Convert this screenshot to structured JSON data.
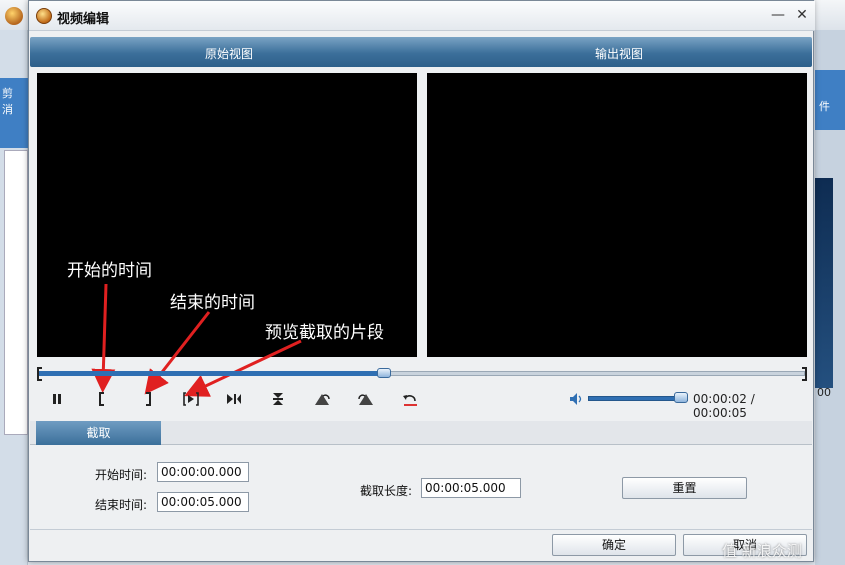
{
  "dialog": {
    "title": "视频编辑"
  },
  "views": {
    "original_label": "原始视图",
    "output_label": "输出视图"
  },
  "annotations": {
    "start_time": "开始的时间",
    "end_time": "结束的时间",
    "preview_clip": "预览截取的片段"
  },
  "timeline": {
    "position_fraction": 0.45
  },
  "playback": {
    "time_readout": "00:00:02 / 00:00:05",
    "volume_fraction": 1.0
  },
  "tabs": [
    {
      "label": "截取"
    }
  ],
  "form": {
    "start_label": "开始时间:",
    "start_value": "00:00:00.000",
    "end_label": "结束时间:",
    "end_value": "00:00:05.000",
    "length_label": "截取长度:",
    "length_value": "00:00:05.000",
    "reset_label": "重置"
  },
  "footer": {
    "ok_label": "确定",
    "cancel_label": "取消"
  },
  "background": {
    "left_text": "剪\n消",
    "right_text": "件",
    "right_number": "00"
  },
  "watermark": "值 新浪众测",
  "colors": {
    "header_blue": "#3b6f9a",
    "slider_blue": "#2f6fb3",
    "arrow_red": "#e02020"
  }
}
